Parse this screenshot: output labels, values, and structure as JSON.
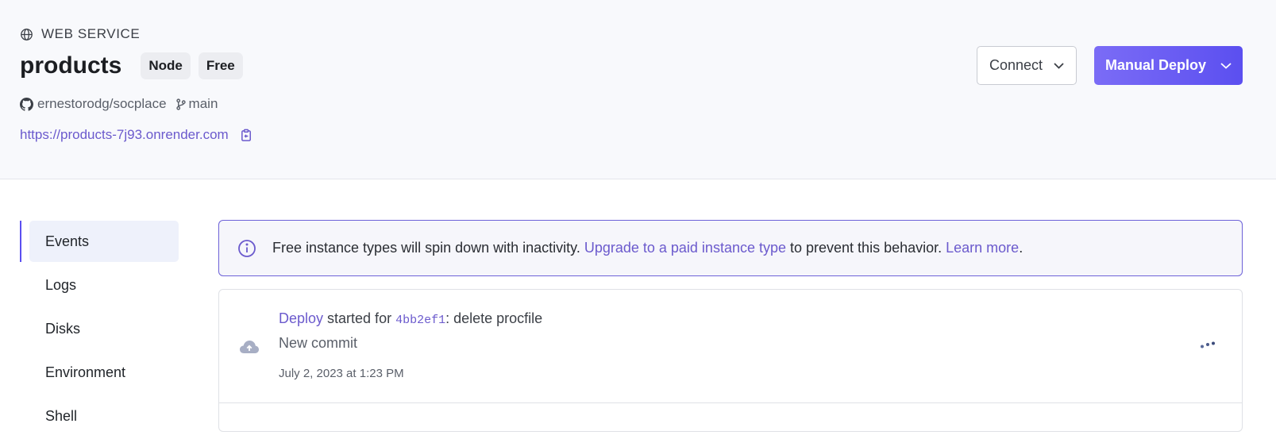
{
  "header": {
    "service_type": "WEB SERVICE",
    "service_name": "products",
    "badges": [
      "Node",
      "Free"
    ],
    "repo": "ernestorodg/socplace",
    "branch": "main",
    "url": "https://products-7j93.onrender.com"
  },
  "actions": {
    "connect_label": "Connect",
    "deploy_label": "Manual Deploy"
  },
  "sidebar": {
    "items": [
      {
        "label": "Events",
        "active": true
      },
      {
        "label": "Logs"
      },
      {
        "label": "Disks"
      },
      {
        "label": "Environment"
      },
      {
        "label": "Shell"
      }
    ]
  },
  "notice": {
    "text_before": "Free instance types will spin down with inactivity. ",
    "upgrade_link": "Upgrade to a paid instance type",
    "text_middle": " to prevent this behavior. ",
    "learn_link": "Learn more",
    "text_after": "."
  },
  "events": [
    {
      "link": "Deploy",
      "text1": " started for ",
      "commit": "4bb2ef1",
      "message": ": delete procfile",
      "subtitle": "New commit",
      "time": "July 2, 2023 at 1:23 PM"
    }
  ],
  "colors": {
    "accent": "#6b5acd",
    "button_gradient_start": "#7b6cf6",
    "button_gradient_end": "#5b4ff0"
  }
}
